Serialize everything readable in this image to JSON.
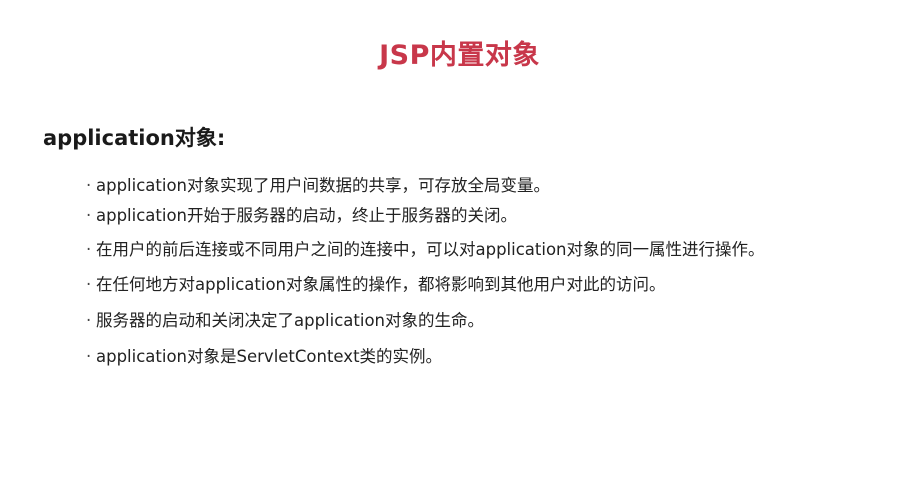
{
  "slide": {
    "title": "JSP内置对象",
    "heading": "application对象:",
    "bullet_marker": "·",
    "bullets": [
      "application对象实现了用户间数据的共享，可存放全局变量。",
      "application开始于服务器的启动，终止于服务器的关闭。",
      "在用户的前后连接或不同用户之间的连接中，可以对application对象的同一属性进行操作。",
      "在任何地方对application对象属性的操作，都将影响到其他用户对此的访问。",
      "服务器的启动和关闭决定了application对象的生命。",
      "application对象是ServletContext类的实例。"
    ]
  },
  "colors": {
    "title": "#c8374a",
    "heading": "#1a1a1a",
    "body_text": "#222222",
    "background": "#ffffff"
  }
}
